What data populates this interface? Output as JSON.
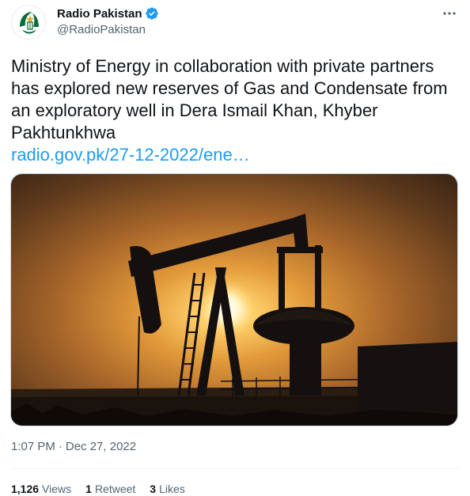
{
  "author": {
    "display_name": "Radio Pakistan",
    "handle": "@RadioPakistan",
    "verified": true,
    "avatar_icon": "radio-pakistan-logo-icon"
  },
  "tweet": {
    "text": "Ministry of Energy in collaboration with private partners has explored new reserves of Gas and Condensate from an exploratory well in Dera Ismail Khan, Khyber Pakhtunkhwa",
    "link": "radio.gov.pk/27-12-2022/ene…"
  },
  "media": {
    "description_icon": "oil-pumpjack-sunset-image"
  },
  "meta": {
    "time": "1:07 PM",
    "separator": "·",
    "date": "Dec 27, 2022"
  },
  "stats": {
    "views_count": "1,126",
    "views_label": "Views",
    "retweets_count": "1",
    "retweets_label": "Retweet",
    "likes_count": "3",
    "likes_label": "Likes"
  },
  "colors": {
    "link": "#1d9bf0",
    "secondary_text": "#536471",
    "verified": "#1d9bf0",
    "logo_green": "#0b6b3a"
  }
}
